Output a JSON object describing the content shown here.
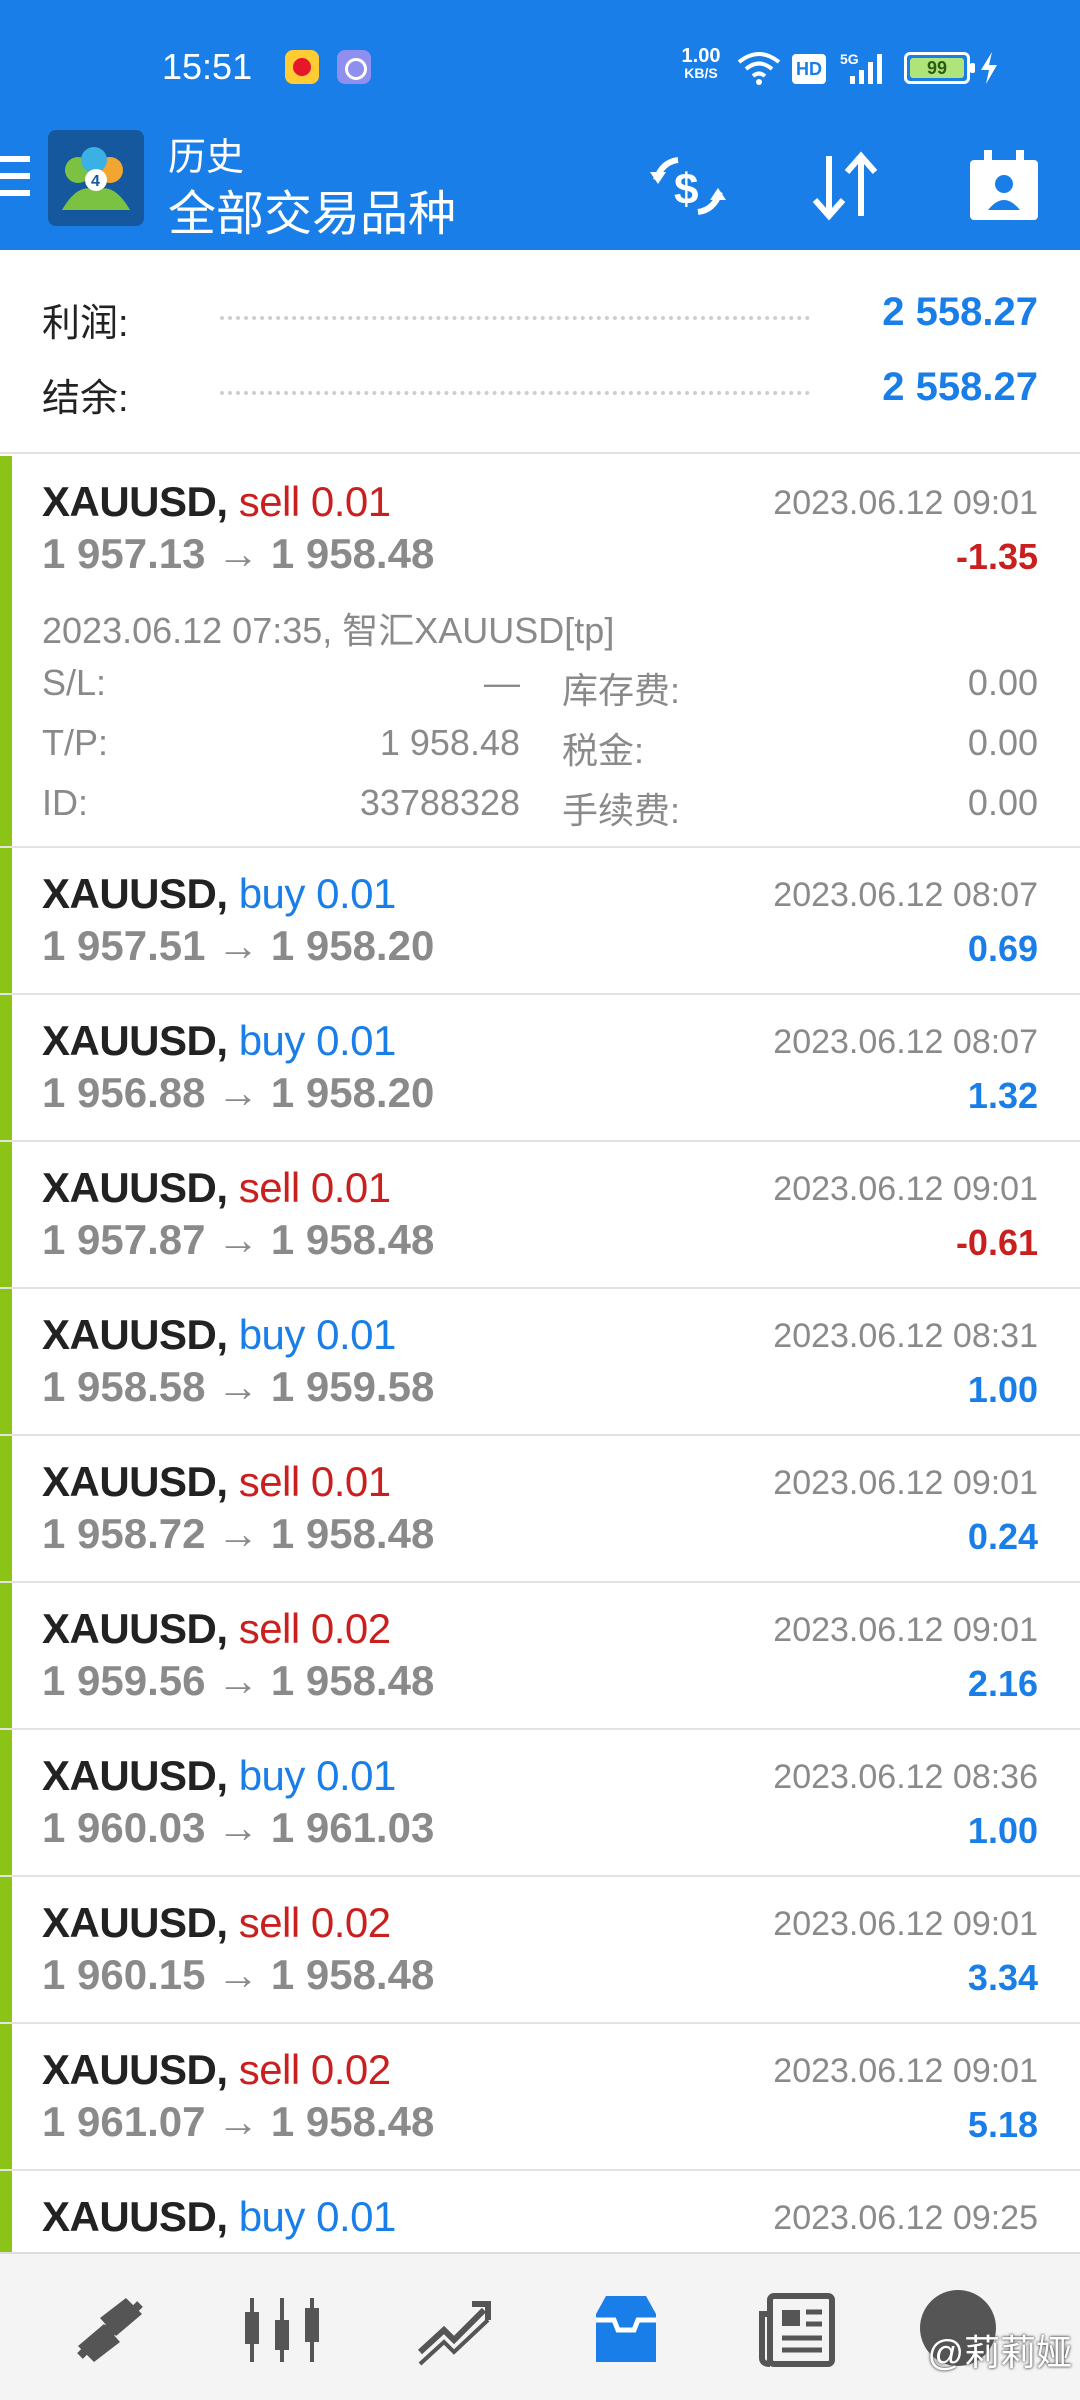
{
  "status_bar": {
    "time": "15:51",
    "net_speed": "1.00",
    "net_unit": "KB/S",
    "hd": "HD",
    "signal": "5G",
    "battery": "99"
  },
  "header": {
    "title": "历史",
    "subtitle": "全部交易品种",
    "icons": [
      "menu-icon",
      "mt4-logo",
      "currency-exchange-icon",
      "sort-icon",
      "account-icon"
    ]
  },
  "summary": {
    "profit_label": "利润:",
    "profit_value": "2 558.27",
    "balance_label": "结余:",
    "balance_value": "2 558.27"
  },
  "expanded": {
    "open_info": "2023.06.12 07:35, 智汇XAUUSD[tp]",
    "sl_label": "S/L:",
    "sl_value": "—",
    "tp_label": "T/P:",
    "tp_value": "1 958.48",
    "id_label": "ID:",
    "id_value": "33788328",
    "swap_label": "库存费:",
    "swap_value": "0.00",
    "tax_label": "税金:",
    "tax_value": "0.00",
    "commission_label": "手续费:",
    "commission_value": "0.00"
  },
  "trades": [
    {
      "symbol": "XAUUSD,",
      "side": "sell 0.01",
      "prices": "1 957.13 → 1 958.48",
      "date": "2023.06.12 09:01",
      "profit": "-1.35"
    },
    {
      "symbol": "XAUUSD,",
      "side": "buy 0.01",
      "prices": "1 957.51 → 1 958.20",
      "date": "2023.06.12 08:07",
      "profit": "0.69"
    },
    {
      "symbol": "XAUUSD,",
      "side": "buy 0.01",
      "prices": "1 956.88 → 1 958.20",
      "date": "2023.06.12 08:07",
      "profit": "1.32"
    },
    {
      "symbol": "XAUUSD,",
      "side": "sell 0.01",
      "prices": "1 957.87 → 1 958.48",
      "date": "2023.06.12 09:01",
      "profit": "-0.61"
    },
    {
      "symbol": "XAUUSD,",
      "side": "buy 0.01",
      "prices": "1 958.58 → 1 959.58",
      "date": "2023.06.12 08:31",
      "profit": "1.00"
    },
    {
      "symbol": "XAUUSD,",
      "side": "sell 0.01",
      "prices": "1 958.72 → 1 958.48",
      "date": "2023.06.12 09:01",
      "profit": "0.24"
    },
    {
      "symbol": "XAUUSD,",
      "side": "sell 0.02",
      "prices": "1 959.56 → 1 958.48",
      "date": "2023.06.12 09:01",
      "profit": "2.16"
    },
    {
      "symbol": "XAUUSD,",
      "side": "buy 0.01",
      "prices": "1 960.03 → 1 961.03",
      "date": "2023.06.12 08:36",
      "profit": "1.00"
    },
    {
      "symbol": "XAUUSD,",
      "side": "sell 0.02",
      "prices": "1 960.15 → 1 958.48",
      "date": "2023.06.12 09:01",
      "profit": "3.34"
    },
    {
      "symbol": "XAUUSD,",
      "side": "sell 0.02",
      "prices": "1 961.07 → 1 958.48",
      "date": "2023.06.12 09:01",
      "profit": "5.18"
    },
    {
      "symbol": "XAUUSD,",
      "side": "buy 0.01",
      "prices": "",
      "date": "2023.06.12 09:25",
      "profit": ""
    }
  ],
  "bottom_nav": {
    "items": [
      "quotes-icon",
      "chart-candles-icon",
      "trade-icon",
      "history-inbox-icon",
      "news-icon"
    ],
    "active": "history-inbox-icon"
  },
  "watermark": "@莉莉娅",
  "colors": {
    "primary": "#1a7ee8",
    "sell": "#c9201f",
    "buy": "#1a7ee8",
    "bar": "#8bc417",
    "muted": "#8a8a8a"
  }
}
